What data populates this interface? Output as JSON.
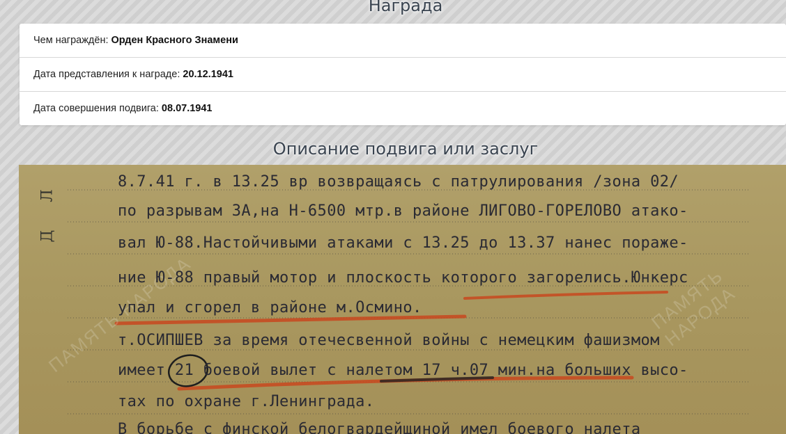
{
  "award_section": {
    "title": "Награда",
    "rows": [
      {
        "label": "Чем награждён: ",
        "value": "Орден Красного Знамени"
      },
      {
        "label": "Дата представления к награде: ",
        "value": "20.12.1941"
      },
      {
        "label": "Дата совершения подвига: ",
        "value": "08.07.1941"
      }
    ]
  },
  "description_section": {
    "title": "Описание подвига или заслуг",
    "margin_letters": [
      "Л",
      "Д"
    ],
    "watermark": "ПАМЯТЬ НАРОДА",
    "lines": [
      "8.7.41 г. в 13.25 вр возвращаясь с патрулирования /зона 02/",
      "по разрывам ЗА,на Н-6500 мтр.в районе ЛИГОВО-ГОРЕЛОВО атако-",
      "вал Ю-88.Настойчивыми атаками с 13.25 до 13.37 нанес пораже-",
      "ние Ю-88 правый мотор и плоскость которого загорелись.Юнкерс",
      "упал и сгорел в районе м.Осмино.",
      "т.ОСИПШЕВ за время отечесвенной войны с немецким фашизмом",
      "имеет 21 боевой вылет с налетом 17 ч.07 мин.на больших высо-",
      "тах по охране г.Ленинграда.",
      "В борьбе с финской белогвардейщиной имел боевого налета"
    ],
    "colors": {
      "paper": "#a99860",
      "ink": "#2a2a33",
      "underline": "#c8481e"
    }
  }
}
